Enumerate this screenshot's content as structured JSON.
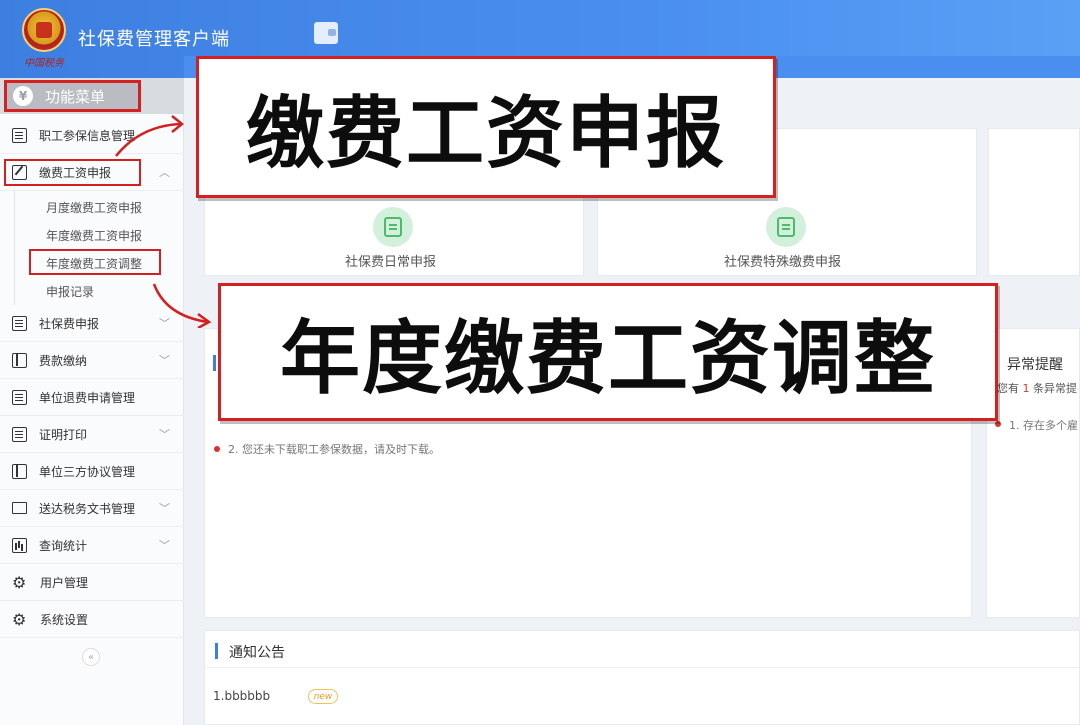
{
  "header": {
    "app_title": "社保费管理客户端",
    "logo_script": "中国税务"
  },
  "sidebar": {
    "menu_head": "功能菜单",
    "items": [
      {
        "label": "职工参保信息管理",
        "icon": "list-icon"
      },
      {
        "label": "缴费工资申报",
        "icon": "edit-icon",
        "expanded": true
      },
      {
        "label": "社保费申报",
        "icon": "list-icon"
      },
      {
        "label": "费款缴纳",
        "icon": "book-icon"
      },
      {
        "label": "单位退费申请管理",
        "icon": "list-icon"
      },
      {
        "label": "证明打印",
        "icon": "print-icon"
      },
      {
        "label": "单位三方协议管理",
        "icon": "book-icon"
      },
      {
        "label": "送达税务文书管理",
        "icon": "print-icon"
      },
      {
        "label": "查询统计",
        "icon": "chart-icon"
      },
      {
        "label": "用户管理",
        "icon": "gear-icon"
      },
      {
        "label": "系统设置",
        "icon": "gear-icon"
      }
    ],
    "sub_items": [
      "月度缴费工资申报",
      "年度缴费工资申报",
      "年度缴费工资调整",
      "申报记录"
    ]
  },
  "main": {
    "quick_cards": [
      "社保费日常申报",
      "社保费特殊缴费申报"
    ],
    "alerts": {
      "title": "异常提醒",
      "summary_prefix": "您有",
      "summary_count": "1",
      "summary_suffix": "条异常提",
      "item": "1. 存在多个雇"
    },
    "messages": [
      "2. 您还未下载职工参保数据，请及时下载。"
    ],
    "notice": {
      "title": "通知公告",
      "items": [
        {
          "text": "1.bbbbbb",
          "badge": "new"
        }
      ]
    }
  },
  "callouts": {
    "top": "缴费工资申报",
    "bottom": "年度缴费工资调整"
  },
  "colors": {
    "header_blue": "#4a8ff0",
    "highlight_red": "#d32020",
    "icon_green": "#4cbb6a"
  }
}
